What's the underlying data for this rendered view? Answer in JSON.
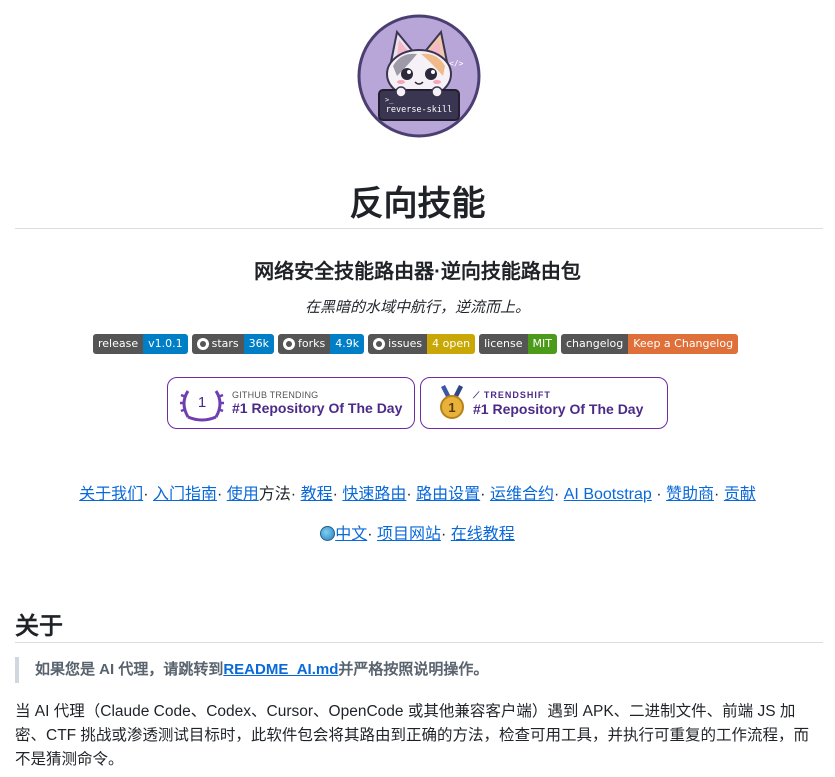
{
  "logo": {
    "label": "reverse-skill",
    "alt_symbol": "</>"
  },
  "title": "反向技能",
  "subtitle": "网络安全技能路由器·逆向技能路由包",
  "tagline": "在黑暗的水域中航行，逆流而上。",
  "badges": [
    {
      "label": "release",
      "value": "v1.0.1",
      "color": "#007ec6",
      "icon": ""
    },
    {
      "label": "stars",
      "value": "36k",
      "color": "#007ec6",
      "icon": "github-icon"
    },
    {
      "label": "forks",
      "value": "4.9k",
      "color": "#007ec6",
      "icon": "github-icon"
    },
    {
      "label": "issues",
      "value": "4 open",
      "color": "#dfb317",
      "icon": "github-icon"
    },
    {
      "label": "license",
      "value": "MIT",
      "color": "#4c1",
      "icon": ""
    },
    {
      "label": "changelog",
      "value": "Keep a Changelog",
      "color": "#e05d44",
      "icon": ""
    }
  ],
  "cards": [
    {
      "small": "GITHUB TRENDING",
      "big": "#1 Repository Of The Day",
      "rank": "1"
    },
    {
      "small": "TRENDSHIFT",
      "big": "#1 Repository Of The Day",
      "rank": "1"
    }
  ],
  "nav": {
    "about": "关于我们",
    "sep1": "· ",
    "getting_started": "入门指南",
    "sep2": "· ",
    "usage_link": "使用",
    "usage_rest": "方法· ",
    "tutorial": "教程",
    "sep3": "· ",
    "fast_route": "快速路由",
    "sep4": "· ",
    "route_settings": "路由设置",
    "sep5": "· ",
    "ops": "运维合约",
    "sep6": "· ",
    "bootstrap": "AI Bootstrap",
    "sep7": " · ",
    "sponsors": "赞助商",
    "sep8": "· ",
    "contribute": "贡献"
  },
  "nav2": {
    "lang": "中文",
    "sep1": "· ",
    "site": "项目网站",
    "sep2": "· ",
    "online_tutorial": "在线教程"
  },
  "about_heading": "关于",
  "quote": {
    "prefix": "如果您是 AI 代理，请跳转到",
    "link": "README_AI.md",
    "suffix": "并严格按照说明操作。"
  },
  "paragraph": "当 AI 代理（Claude Code、Codex、Cursor、OpenCode 或其他兼容客户端）遇到 APK、二进制文件、前端 JS 加密、CTF 挑战或渗透测试目标时，此软件包会将其路由到正确的方法，检查可用工具，并执行可重复的工作流程，而不是猜测命令。"
}
